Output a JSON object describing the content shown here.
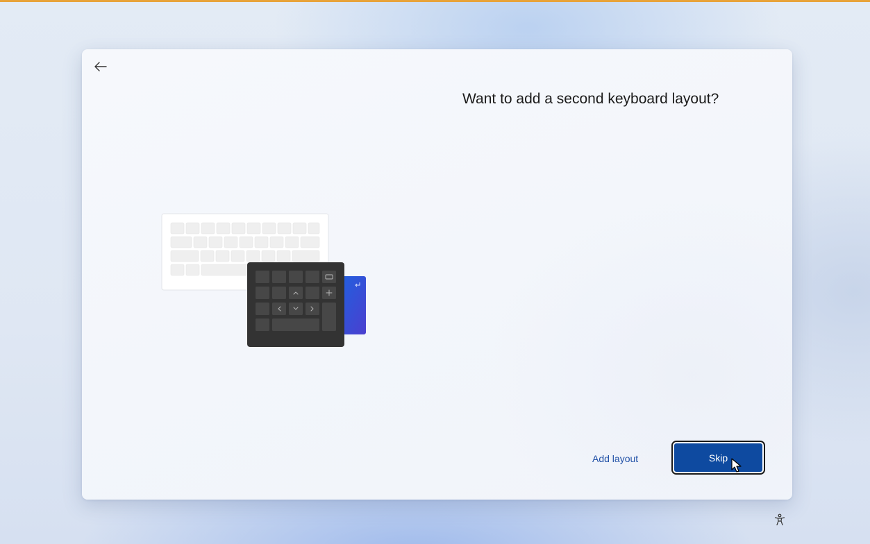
{
  "setup_page": {
    "title": "Want to add a second keyboard layout?",
    "back_icon": "arrow-left-icon",
    "illustration": "keyboard-layout-illustration",
    "add_layout_label": "Add layout",
    "skip_label": "Skip"
  },
  "footer": {
    "accessibility_icon": "accessibility-icon"
  },
  "colors": {
    "accent": "#0e4aa0",
    "link": "#1f4fa6",
    "top_border": "#e8a33a"
  }
}
